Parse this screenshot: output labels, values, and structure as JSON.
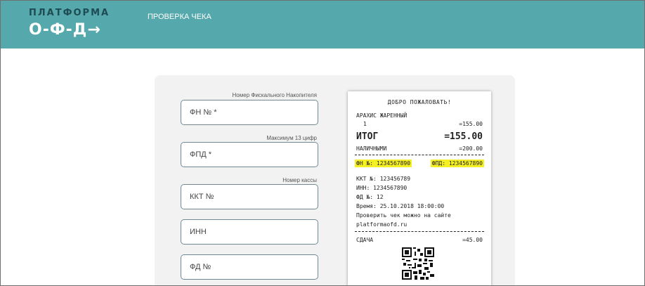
{
  "header": {
    "logo_top": "ПЛАТФОРМА",
    "logo_bottom": "О-Ф-Д→",
    "nav_link": "ПРОВЕРКА ЧЕКА"
  },
  "form": {
    "fn": {
      "label": "Номер Фискального Накопителя",
      "placeholder": "ФН № *"
    },
    "fpd": {
      "label": "Максимум 13 цифр",
      "placeholder": "ФПД *"
    },
    "kkt": {
      "label": "Номер кассы",
      "placeholder": "ККТ №"
    },
    "inn": {
      "placeholder": "ИНН"
    },
    "fd": {
      "placeholder": "ФД №"
    }
  },
  "receipt": {
    "welcome": "ДОБРО ПОЖАЛОВАТЬ!",
    "item_name": "АРАХИС ЖАРЕННЫЙ",
    "item_qty": "1",
    "item_price": "=155.00",
    "total_label": "ИТОГ",
    "total_value": "=155.00",
    "cash_label": "НАЛИЧНЫМИ",
    "cash_value": "=200.00",
    "fn_highlight": "ФН №: 1234567890",
    "fpd_highlight": "ФПД: 1234567890",
    "kkt": "ККТ №: 123456789",
    "inn": "ИНН: 1234567890",
    "fd": "ФД №: 12",
    "time": "Время: 25.10.2018 18:00:00",
    "check_text": "Проверить чек можно на сайте",
    "site": "platformaofd.ru",
    "change_label": "СДАЧА",
    "change_value": "=45.00"
  },
  "colors": {
    "header_bg": "#55a8ab",
    "logo_dark": "#1d4c52",
    "highlight": "#f5f023",
    "field_border": "#6f8a94"
  },
  "icons": [
    "qr-code-icon"
  ]
}
